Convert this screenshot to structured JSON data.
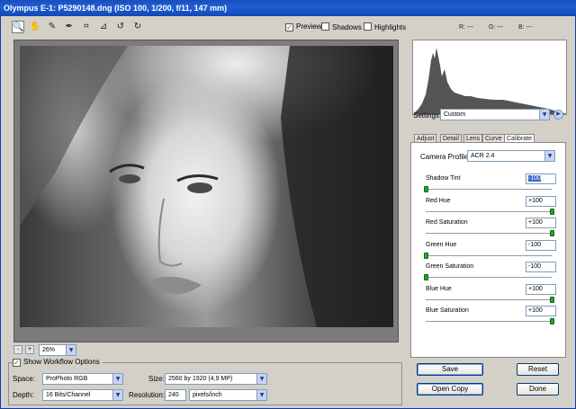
{
  "window": {
    "title": "Olympus E-1:  P5290148.dng  (ISO 100, 1/200, f/11, 147 mm)"
  },
  "toolbar": {
    "tools": [
      {
        "name": "zoom-tool-icon",
        "glyph": "🔍"
      },
      {
        "name": "hand-tool-icon",
        "glyph": "✋"
      },
      {
        "name": "white-balance-tool-icon",
        "glyph": "✎"
      },
      {
        "name": "color-sampler-tool-icon",
        "glyph": "✒"
      },
      {
        "name": "crop-tool-icon",
        "glyph": "⌗"
      },
      {
        "name": "straighten-tool-icon",
        "glyph": "⊿"
      },
      {
        "name": "rotate-left-icon",
        "glyph": "↺"
      },
      {
        "name": "rotate-right-icon",
        "glyph": "↻"
      }
    ],
    "preview_label": "Preview",
    "preview_checked": true,
    "shadows_label": "Shadows",
    "shadows_checked": false,
    "highlights_label": "Highlights",
    "highlights_checked": false,
    "r_label": "R: ---",
    "g_label": "G: ---",
    "b_label": "B: ---"
  },
  "zoom": {
    "minus": "-",
    "plus": "+",
    "value": "26%"
  },
  "workflow": {
    "show_label": "Show Workflow Options",
    "show_checked": true,
    "space_label": "Space:",
    "space_value": "ProPhoto RGB",
    "size_label": "Size:",
    "size_value": "2560 by 1920  (4,9 MP)",
    "depth_label": "Depth:",
    "depth_value": "16 Bits/Channel",
    "resolution_label": "Resolution:",
    "resolution_value": "240",
    "resolution_unit": "pixels/inch"
  },
  "settings": {
    "label": "Settings:",
    "value": "Custom"
  },
  "tabs": [
    "Adjust",
    "Detail",
    "Lens",
    "Curve",
    "Calibrate"
  ],
  "active_tab": "Calibrate",
  "calibrate": {
    "profile_label": "Camera Profile:",
    "profile_value": "ACR 2.4",
    "sliders": [
      {
        "label": "Shadow Tint",
        "value": "-100",
        "fraction": 0.0,
        "highlight": true
      },
      {
        "label": "Red Hue",
        "value": "+100",
        "fraction": 1.0
      },
      {
        "label": "Red Saturation",
        "value": "+100",
        "fraction": 1.0
      },
      {
        "label": "Green Hue",
        "value": "-100",
        "fraction": 0.0
      },
      {
        "label": "Green Saturation",
        "value": "-100",
        "fraction": 0.0
      },
      {
        "label": "Blue Hue",
        "value": "+100",
        "fraction": 1.0
      },
      {
        "label": "Blue Saturation",
        "value": "+100",
        "fraction": 1.0
      }
    ]
  },
  "buttons": {
    "save": "Save",
    "reset": "Reset",
    "open": "Open Copy",
    "done": "Done"
  }
}
